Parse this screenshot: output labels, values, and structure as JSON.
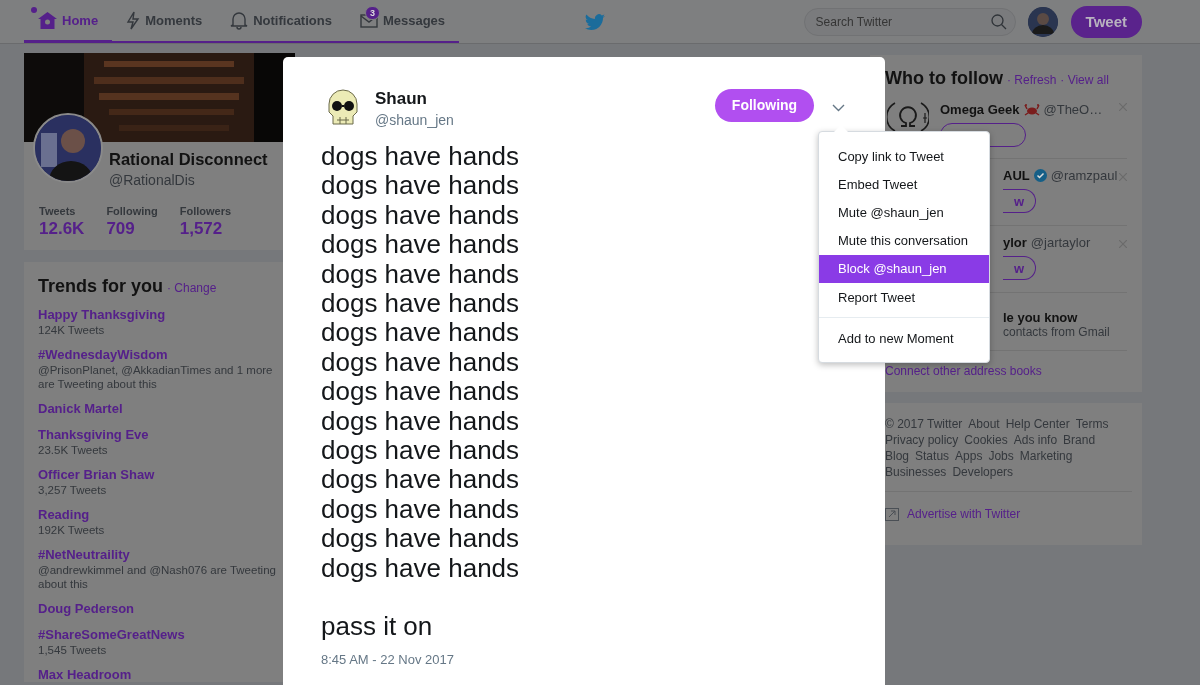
{
  "nav": {
    "tabs": [
      {
        "label": "Home",
        "selected": true,
        "unread": true
      },
      {
        "label": "Moments",
        "selected": false,
        "unread": false
      },
      {
        "label": "Notifications",
        "selected": false,
        "unread": false
      },
      {
        "label": "Messages",
        "selected": false,
        "unread": false,
        "badge": "3"
      }
    ],
    "search": {
      "placeholder": "Search Twitter"
    },
    "tweet_button": "Tweet"
  },
  "profile": {
    "name": "Rational Disconnect",
    "handle": "@RationalDis",
    "stats": [
      {
        "label": "Tweets",
        "value": "12.6K"
      },
      {
        "label": "Following",
        "value": "709"
      },
      {
        "label": "Followers",
        "value": "1,572"
      }
    ]
  },
  "trends": {
    "title": "Trends for you",
    "change": "· Change",
    "items": [
      {
        "name": "Happy Thanksgiving",
        "meta": "124K Tweets"
      },
      {
        "name": "#WednesdayWisdom",
        "meta": "@PrisonPlanet, @AkkadianTimes and 1 more are Tweeting about this"
      },
      {
        "name": "Danick Martel"
      },
      {
        "name": "Thanksgiving Eve",
        "meta": "23.5K Tweets"
      },
      {
        "name": "Officer Brian Shaw",
        "meta": "3,257 Tweets"
      },
      {
        "name": "Reading",
        "meta": "192K Tweets"
      },
      {
        "name": "#NetNeutraility",
        "meta": "@andrewkimmel and @Nash076 are Tweeting about this"
      },
      {
        "name": "Doug Pederson"
      },
      {
        "name": "#ShareSomeGreatNews",
        "meta": "1,545 Tweets"
      },
      {
        "name": "Max Headroom"
      }
    ]
  },
  "who_to_follow": {
    "title": "Who to follow",
    "refresh": "· Refresh",
    "view_all": "· View all",
    "accounts": [
      {
        "name": "Omega Geek",
        "handle": "@TheO…",
        "verified": false,
        "covered": false
      },
      {
        "name": "AUL",
        "handle": "@ramzpaul",
        "verified": true,
        "button": "w",
        "covered": true
      },
      {
        "name": "ylor",
        "handle": "@jartaylor",
        "verified": false,
        "button": "w",
        "covered": true
      }
    ],
    "people": {
      "title": "le you know",
      "subtitle": "contacts from Gmail"
    },
    "connect": "Connect other address books"
  },
  "footer": {
    "links": [
      "© 2017 Twitter",
      "About",
      "Help Center",
      "Terms",
      "Privacy policy",
      "Cookies",
      "Ads info",
      "Brand",
      "Blog",
      "Status",
      "Apps",
      "Jobs",
      "Marketing",
      "Businesses",
      "Developers"
    ],
    "advertise": "Advertise with Twitter"
  },
  "tweet": {
    "name": "Shaun",
    "handle": "@shaun_jen",
    "follow_button": "Following",
    "paragraphs": [
      [
        "dogs have hands",
        "dogs have hands",
        "dogs have hands",
        "dogs have hands",
        "dogs have hands",
        "dogs have hands",
        "dogs have hands",
        "dogs have hands",
        "dogs have hands",
        "dogs have hands",
        "dogs have hands",
        "dogs have hands",
        "dogs have hands",
        "dogs have hands",
        "dogs have hands"
      ],
      [
        "pass it on"
      ]
    ],
    "time": "8:45 AM - 22 Nov 2017"
  },
  "menu": {
    "groups": [
      [
        {
          "label": "Copy link to Tweet",
          "selected": false
        },
        {
          "label": "Embed Tweet",
          "selected": false
        },
        {
          "label": "Mute @shaun_jen",
          "selected": false
        },
        {
          "label": "Mute this conversation",
          "selected": false
        },
        {
          "label": "Block @shaun_jen",
          "selected": true
        },
        {
          "label": "Report Tweet",
          "selected": false
        }
      ],
      [
        {
          "label": "Add to new Moment",
          "selected": false
        }
      ]
    ]
  }
}
